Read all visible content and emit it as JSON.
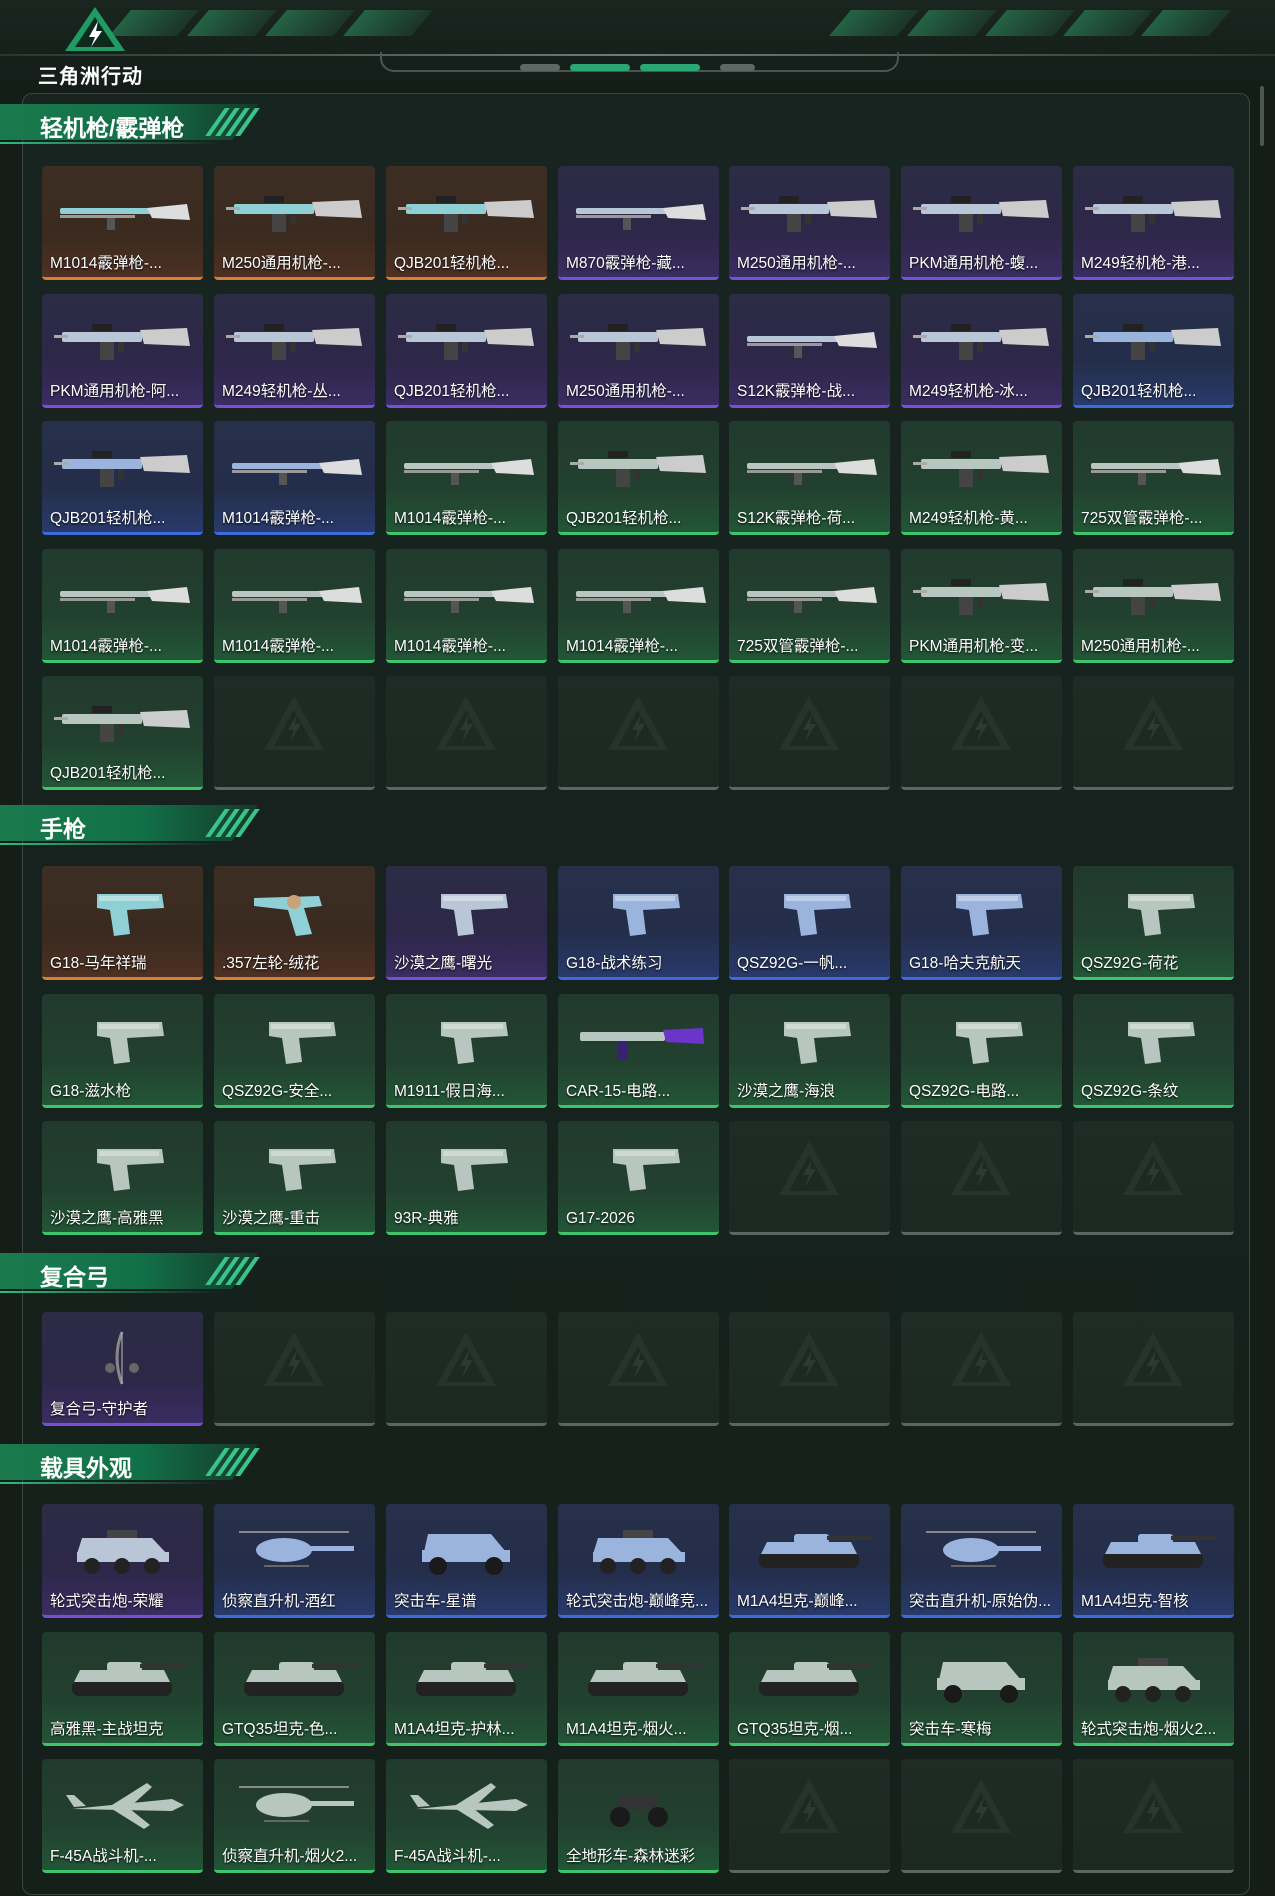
{
  "header": {
    "logo_text": "三角洲行动",
    "colors": {
      "accent": "#2aa873",
      "background": "#141d18"
    }
  },
  "sections": [
    {
      "title": "轻机枪/霰弹枪",
      "cards": [
        {
          "label": "M1014霰弹枪-...",
          "rarity": "gold",
          "icon": "shotgun-icon"
        },
        {
          "label": "M250通用机枪-...",
          "rarity": "gold",
          "icon": "machine-gun-icon"
        },
        {
          "label": "QJB201轻机枪...",
          "rarity": "gold",
          "icon": "machine-gun-icon"
        },
        {
          "label": "M870霰弹枪-藏...",
          "rarity": "purple",
          "icon": "shotgun-icon"
        },
        {
          "label": "M250通用机枪-...",
          "rarity": "purple",
          "icon": "machine-gun-icon"
        },
        {
          "label": "PKM通用机枪-蝮...",
          "rarity": "purple",
          "icon": "machine-gun-icon"
        },
        {
          "label": "M249轻机枪-港...",
          "rarity": "purple",
          "icon": "machine-gun-icon"
        },
        {
          "label": "PKM通用机枪-阿...",
          "rarity": "purple",
          "icon": "machine-gun-icon"
        },
        {
          "label": "M249轻机枪-丛...",
          "rarity": "purple",
          "icon": "machine-gun-icon"
        },
        {
          "label": "QJB201轻机枪...",
          "rarity": "purple",
          "icon": "machine-gun-icon"
        },
        {
          "label": "M250通用机枪-...",
          "rarity": "purple",
          "icon": "machine-gun-icon"
        },
        {
          "label": "S12K霰弹枪-战...",
          "rarity": "purple",
          "icon": "shotgun-icon"
        },
        {
          "label": "M249轻机枪-冰...",
          "rarity": "purple",
          "icon": "machine-gun-icon"
        },
        {
          "label": "QJB201轻机枪...",
          "rarity": "blue",
          "icon": "machine-gun-icon"
        },
        {
          "label": "QJB201轻机枪...",
          "rarity": "blue",
          "icon": "machine-gun-icon"
        },
        {
          "label": "M1014霰弹枪-...",
          "rarity": "blue",
          "icon": "shotgun-icon"
        },
        {
          "label": "M1014霰弹枪-...",
          "rarity": "green",
          "icon": "shotgun-icon"
        },
        {
          "label": "QJB201轻机枪...",
          "rarity": "green",
          "icon": "machine-gun-icon"
        },
        {
          "label": "S12K霰弹枪-荷...",
          "rarity": "green",
          "icon": "shotgun-icon"
        },
        {
          "label": "M249轻机枪-黄...",
          "rarity": "green",
          "icon": "machine-gun-icon"
        },
        {
          "label": "725双管霰弹枪-...",
          "rarity": "green",
          "icon": "shotgun-icon"
        },
        {
          "label": "M1014霰弹枪-...",
          "rarity": "green",
          "icon": "shotgun-icon"
        },
        {
          "label": "M1014霰弹枪-...",
          "rarity": "green",
          "icon": "shotgun-icon"
        },
        {
          "label": "M1014霰弹枪-...",
          "rarity": "green",
          "icon": "shotgun-icon"
        },
        {
          "label": "M1014霰弹枪-...",
          "rarity": "green",
          "icon": "shotgun-icon"
        },
        {
          "label": "725双管霰弹枪-...",
          "rarity": "green",
          "icon": "shotgun-icon"
        },
        {
          "label": "PKM通用机枪-变...",
          "rarity": "green",
          "icon": "machine-gun-icon"
        },
        {
          "label": "M250通用机枪-...",
          "rarity": "green",
          "icon": "machine-gun-icon"
        },
        {
          "label": "QJB201轻机枪...",
          "rarity": "green",
          "icon": "machine-gun-icon"
        }
      ]
    },
    {
      "title": "手枪",
      "cards": [
        {
          "label": "G18-马年祥瑞",
          "rarity": "gold",
          "icon": "pistol-icon"
        },
        {
          "label": ".357左轮-绒花",
          "rarity": "gold",
          "icon": "revolver-icon"
        },
        {
          "label": "沙漠之鹰-曙光",
          "rarity": "purple",
          "icon": "pistol-icon"
        },
        {
          "label": "G18-战术练习",
          "rarity": "blue",
          "icon": "pistol-icon"
        },
        {
          "label": "QSZ92G-一帆...",
          "rarity": "blue",
          "icon": "pistol-icon"
        },
        {
          "label": "G18-哈夫克航天",
          "rarity": "blue",
          "icon": "pistol-icon"
        },
        {
          "label": "QSZ92G-荷花",
          "rarity": "green",
          "icon": "pistol-icon"
        },
        {
          "label": "G18-滋水枪",
          "rarity": "green",
          "icon": "pistol-icon"
        },
        {
          "label": "QSZ92G-安全...",
          "rarity": "green",
          "icon": "pistol-icon"
        },
        {
          "label": "M1911-假日海...",
          "rarity": "green",
          "icon": "pistol-icon"
        },
        {
          "label": "CAR-15-电路...",
          "rarity": "green",
          "icon": "rifle-icon"
        },
        {
          "label": "沙漠之鹰-海浪",
          "rarity": "green",
          "icon": "pistol-icon"
        },
        {
          "label": "QSZ92G-电路...",
          "rarity": "green",
          "icon": "pistol-icon"
        },
        {
          "label": "QSZ92G-条纹",
          "rarity": "green",
          "icon": "pistol-icon"
        },
        {
          "label": "沙漠之鹰-高雅黑",
          "rarity": "green",
          "icon": "pistol-icon"
        },
        {
          "label": "沙漠之鹰-重击",
          "rarity": "green",
          "icon": "pistol-icon"
        },
        {
          "label": "93R-典雅",
          "rarity": "green",
          "icon": "pistol-icon"
        },
        {
          "label": "G17-2026",
          "rarity": "green",
          "icon": "pistol-icon"
        }
      ]
    },
    {
      "title": "复合弓",
      "cards": [
        {
          "label": "复合弓-守护者",
          "rarity": "purple",
          "icon": "bow-icon"
        }
      ]
    },
    {
      "title": "载具外观",
      "cards": [
        {
          "label": "轮式突击炮-荣耀",
          "rarity": "purple",
          "icon": "armored-car-icon"
        },
        {
          "label": "侦察直升机-酒红",
          "rarity": "blue",
          "icon": "helicopter-icon"
        },
        {
          "label": "突击车-星谱",
          "rarity": "blue",
          "icon": "assault-vehicle-icon"
        },
        {
          "label": "轮式突击炮-巅峰竞...",
          "rarity": "blue",
          "icon": "armored-car-icon"
        },
        {
          "label": "M1A4坦克-巅峰...",
          "rarity": "blue",
          "icon": "tank-icon"
        },
        {
          "label": "突击直升机-原始伪...",
          "rarity": "blue",
          "icon": "helicopter-icon"
        },
        {
          "label": "M1A4坦克-智核",
          "rarity": "blue",
          "icon": "tank-icon"
        },
        {
          "label": "高雅黑-主战坦克",
          "rarity": "green",
          "icon": "tank-icon"
        },
        {
          "label": "GTQ35坦克-色...",
          "rarity": "green",
          "icon": "tank-icon"
        },
        {
          "label": "M1A4坦克-护林...",
          "rarity": "green",
          "icon": "tank-icon"
        },
        {
          "label": "M1A4坦克-烟火...",
          "rarity": "green",
          "icon": "tank-icon"
        },
        {
          "label": "GTQ35坦克-烟...",
          "rarity": "green",
          "icon": "tank-icon"
        },
        {
          "label": "突击车-寒梅",
          "rarity": "green",
          "icon": "assault-vehicle-icon"
        },
        {
          "label": "轮式突击炮-烟火2...",
          "rarity": "green",
          "icon": "armored-car-icon"
        },
        {
          "label": "F-45A战斗机-...",
          "rarity": "green",
          "icon": "jet-icon"
        },
        {
          "label": "侦察直升机-烟火2...",
          "rarity": "green",
          "icon": "helicopter-icon"
        },
        {
          "label": "F-45A战斗机-...",
          "rarity": "green",
          "icon": "jet-icon"
        },
        {
          "label": "全地形车-森林迷彩",
          "rarity": "green",
          "icon": "atv-icon"
        }
      ]
    }
  ]
}
